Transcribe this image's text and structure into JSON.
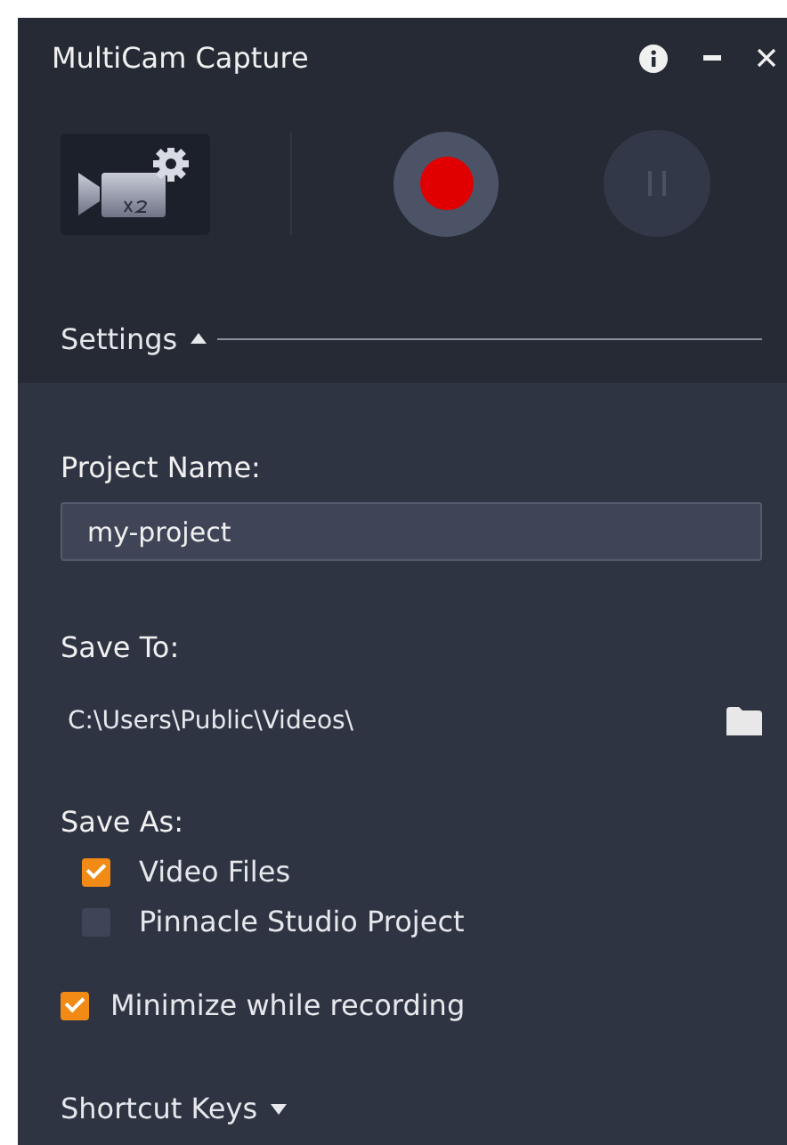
{
  "window": {
    "title": "MultiCam Capture"
  },
  "settings": {
    "label": "Settings",
    "expanded": true
  },
  "project_name": {
    "label": "Project Name:",
    "value": "my-project"
  },
  "save_to": {
    "label": "Save To:",
    "path": "C:\\Users\\Public\\Videos\\"
  },
  "save_as": {
    "label": "Save As:",
    "options": [
      {
        "label": "Video Files",
        "checked": true
      },
      {
        "label": "Pinnacle Studio Project",
        "checked": false
      }
    ]
  },
  "minimize": {
    "label": "Minimize while recording",
    "checked": true
  },
  "shortcut_keys": {
    "label": "Shortcut Keys",
    "expanded": false
  }
}
